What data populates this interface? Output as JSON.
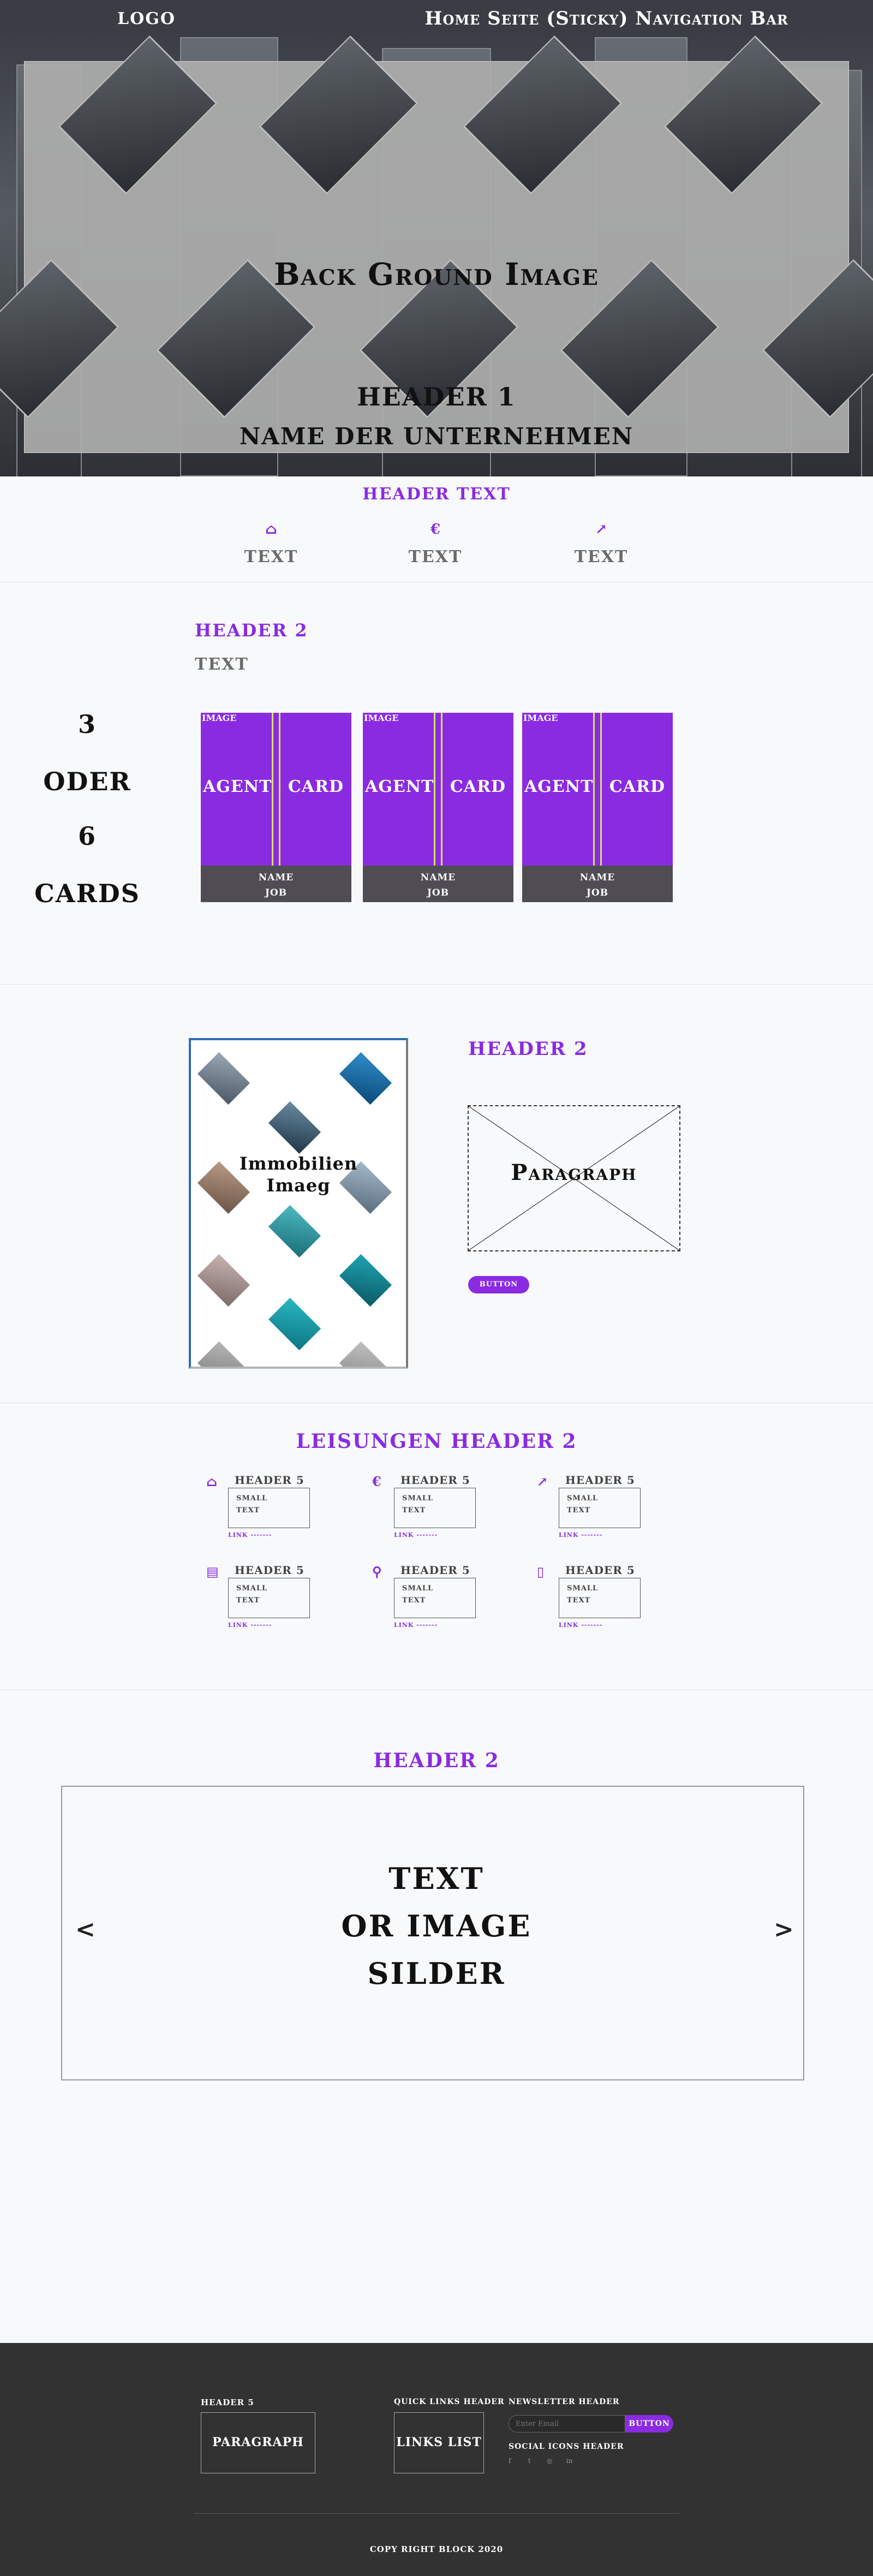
{
  "nav": {
    "logo": "LOGO",
    "title": "Home Seite (Sticky) Navigation Bar"
  },
  "hero": {
    "bg_label": "Back Ground Image",
    "h1": "HEADER 1",
    "company": "NAME DER UNTERNEHMEN"
  },
  "features": {
    "header": "HEADER TEXT",
    "items": [
      {
        "icon": "home-icon",
        "glyph": "⌂",
        "label": "TEXT"
      },
      {
        "icon": "euro-icon",
        "glyph": "€",
        "label": "TEXT"
      },
      {
        "icon": "chart-line-icon",
        "glyph": "↗",
        "label": "TEXT"
      }
    ]
  },
  "team": {
    "header": "HEADER 2",
    "text": "TEXT",
    "count_words": [
      "3",
      "ODER",
      "6",
      "CARDS"
    ],
    "cards": [
      {
        "image": "IMAGE",
        "agent": "AGENT",
        "card": "CARD",
        "name": "NAME",
        "job": "JOB"
      },
      {
        "image": "IMAGE",
        "agent": "AGENT",
        "card": "CARD",
        "name": "NAME",
        "job": "JOB"
      },
      {
        "image": "IMAGE",
        "agent": "AGENT",
        "card": "CARD",
        "name": "NAME",
        "job": "JOB"
      }
    ]
  },
  "about": {
    "image_label_1": "Immobilien",
    "image_label_2": "Imaeg",
    "header": "HEADER 2",
    "paragraph": "Paragraph",
    "button": "BUTTON"
  },
  "services": {
    "header": "LEISUNGEN HEADER 2",
    "items": [
      {
        "icon": "home-icon",
        "glyph": "⌂",
        "header": "HEADER 5",
        "line1": "SMALL",
        "line2": "TEXT",
        "link": "LINK -------"
      },
      {
        "icon": "euro-icon",
        "glyph": "€",
        "header": "HEADER 5",
        "line1": "SMALL",
        "line2": "TEXT",
        "link": "LINK -------"
      },
      {
        "icon": "chart-line-icon",
        "glyph": "↗",
        "header": "HEADER 5",
        "line1": "SMALL",
        "line2": "TEXT",
        "link": "LINK -------"
      },
      {
        "icon": "building-icon",
        "glyph": "▤",
        "header": "HEADER 5",
        "line1": "SMALL",
        "line2": "TEXT",
        "link": "LINK -------"
      },
      {
        "icon": "search-icon",
        "glyph": "⚲",
        "header": "HEADER 5",
        "line1": "SMALL",
        "line2": "TEXT",
        "link": "LINK -------"
      },
      {
        "icon": "mobile-icon",
        "glyph": "▯",
        "header": "HEADER 5",
        "line1": "SMALL",
        "line2": "TEXT",
        "link": "LINK -------"
      }
    ]
  },
  "slider": {
    "header": "HEADER 2",
    "lines": [
      "TEXT",
      "OR IMAGE",
      "SILDER"
    ],
    "prev": "<",
    "next": ">"
  },
  "footer": {
    "col1_title": "HEADER 5",
    "col1_box": "PARAGRAPH",
    "col2_title": "QUICK LINKS HEADER",
    "col2_box": "LINKS LIST",
    "newsletter_title": "NEWSLETTER HEADER",
    "newsletter_placeholder": "Enter Email",
    "newsletter_button": "BUTTON",
    "social_title": "SOCIAL ICONS HEADER",
    "social_icons": [
      {
        "icon": "facebook-icon",
        "glyph": "f"
      },
      {
        "icon": "twitter-icon",
        "glyph": "t"
      },
      {
        "icon": "instagram-icon",
        "glyph": "◎"
      },
      {
        "icon": "linkedin-icon",
        "glyph": "in"
      }
    ],
    "copyright": "COPY RIGHT BLOCK 2020"
  }
}
